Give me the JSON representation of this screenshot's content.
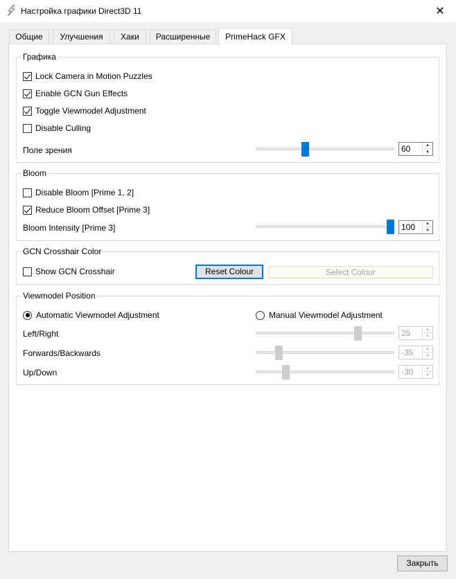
{
  "window": {
    "title": "Настройка графики Direct3D 11",
    "close_glyph": "✕"
  },
  "tabs": [
    {
      "label": "Общие",
      "active": false
    },
    {
      "label": "Улучшения",
      "active": false
    },
    {
      "label": "Хаки",
      "active": false
    },
    {
      "label": "Расширенные",
      "active": false
    },
    {
      "label": "PrimeHack GFX",
      "active": true
    }
  ],
  "graphics": {
    "title": "Графика",
    "lock_camera": {
      "label": "Lock Camera in Motion Puzzles",
      "checked": true
    },
    "gun_effects": {
      "label": "Enable GCN Gun Effects",
      "checked": true
    },
    "viewmodel_adj": {
      "label": "Toggle Viewmodel Adjustment",
      "checked": true
    },
    "disable_culling": {
      "label": "Disable Culling",
      "checked": false
    },
    "fov": {
      "label": "Поле зрения",
      "value": "60"
    }
  },
  "bloom": {
    "title": "Bloom",
    "disable_bloom": {
      "label": "Disable Bloom [Prime 1, 2]",
      "checked": false
    },
    "reduce_offset": {
      "label": "Reduce Bloom Offset [Prime 3]",
      "checked": true
    },
    "intensity": {
      "label": "Bloom Intensity [Prime 3]",
      "value": "100"
    }
  },
  "crosshair": {
    "title": "GCN Crosshair Color",
    "show": {
      "label": "Show GCN Crosshair",
      "checked": false
    },
    "reset_label": "Reset Colour",
    "select_label": "Select Colour"
  },
  "viewmodel": {
    "title": "Viewmodel Position",
    "automatic": {
      "label": "Automatic Viewmodel Adjustment",
      "selected": true
    },
    "manual": {
      "label": "Manual Viewmodel Adjustment",
      "selected": false
    },
    "left_right": {
      "label": "Left/Right",
      "value": "25"
    },
    "forwards_backwards": {
      "label": "Forwards/Backwards",
      "value": "-35"
    },
    "up_down": {
      "label": "Up/Down",
      "value": "-30"
    }
  },
  "footer": {
    "close_label": "Закрыть"
  },
  "colors": {
    "accent": "#0078d7",
    "window_bg": "#f0f0f0",
    "panel_bg": "#ffffff"
  }
}
